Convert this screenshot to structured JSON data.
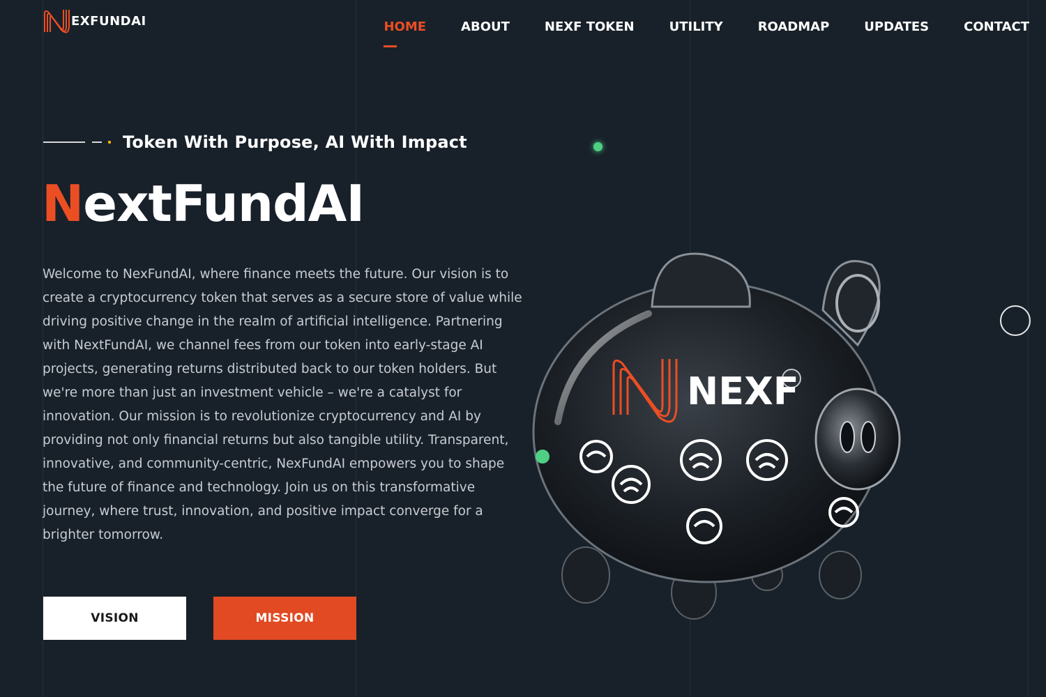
{
  "header": {
    "logo_text": "EXFUNDAI",
    "nav": [
      {
        "label": "HOME",
        "active": true
      },
      {
        "label": "ABOUT",
        "active": false
      },
      {
        "label": "NEXF TOKEN",
        "active": false
      },
      {
        "label": "UTILITY",
        "active": false
      },
      {
        "label": "ROADMAP",
        "active": false
      },
      {
        "label": "UPDATES",
        "active": false
      },
      {
        "label": "CONTACT",
        "active": false
      }
    ]
  },
  "hero": {
    "tagline": "Token With Purpose, AI With Impact",
    "title_accent": "N",
    "title_rest": "extFundAI",
    "body": "Welcome to NexFundAI, where finance meets the future. Our vision is to create a cryptocurrency token that serves as a secure store of value while driving positive change in the realm of artificial intelligence. Partnering with NextFundAI, we channel fees from our token into early-stage AI projects, generating returns distributed back to our token holders. But we're more than just an investment vehicle – we're a catalyst for innovation. Our mission is to revolutionize cryptocurrency and AI by providing not only financial returns but also tangible utility. Transparent, innovative, and community-centric, NexFundAI empowers you to shape the future of finance and technology. Join us on this transformative journey, where trust, innovation, and positive impact converge for a brighter tomorrow.",
    "buttons": {
      "vision": "VISION",
      "mission": "MISSION"
    }
  },
  "illustration": {
    "label": "NEXF",
    "icons": [
      "nexf-logo-icon",
      "glass-piggy-bank-icon",
      "scroll-ring-icon"
    ]
  },
  "colors": {
    "background": "#18212a",
    "accent": "#ec4e24",
    "button_light": "#ffffff",
    "green_dot": "#4fcf83",
    "tagline_marker": "#f2b100"
  }
}
